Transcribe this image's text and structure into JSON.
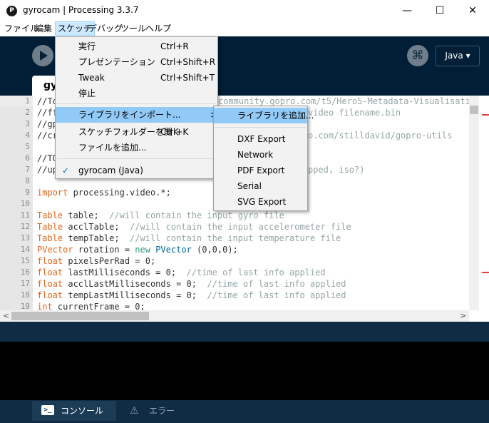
{
  "window": {
    "app_icon": "P",
    "title": "gyrocam | Processing 3.3.7",
    "minimize": "—",
    "maximize": "☐",
    "close": "✕"
  },
  "menubar": [
    "ファイル",
    "編集",
    "スケッチ",
    "デバッグ",
    "ツール",
    "ヘルプ"
  ],
  "toolbar": {
    "mode": "Java ▾",
    "debug_glyph": "⌘"
  },
  "tab": {
    "label": "gy"
  },
  "editor": {
    "line_numbers": [
      "1",
      "2",
      "3",
      "4",
      "5",
      "6",
      "7",
      "8",
      "9",
      "10",
      "11",
      "12",
      "13",
      "14",
      "15",
      "16",
      "17",
      "18",
      "19"
    ],
    "visible_fragments": {
      "l1": "//To",
      "l1_right": "community.gopro.com/t5/Hero5-Metadata-Visualisation",
      "l2": "//ff",
      "l2_right": "video filename.bin",
      "l3": "//gp",
      "l4": "//cr",
      "l4_right": "o.com/stilldavid/gopro-utils",
      "l6": "//TO",
      "l7": "//up",
      "l7_right": "pped, iso?)"
    },
    "l9_kw": "import",
    "l9_rest": " processing.video.*;",
    "l11_type": "Table",
    "l11_rest": " table;  ",
    "l11_comment": "//will contain the input gyro file",
    "l12_type": "Table",
    "l12_rest": " acclTable;  ",
    "l12_comment": "//will contain the input accelerometer file",
    "l13_type": "Table",
    "l13_rest": " tempTable;  ",
    "l13_comment": "//will contain the input temperature file",
    "l14_type": "PVector",
    "l14_a": " rotation = ",
    "l14_new": "new",
    "l14_cls": " PVector",
    "l14_b": " (0,0,0);",
    "l15_type": "float",
    "l15_rest": " pixelsPerRad = 0;",
    "l16_type": "float",
    "l16_rest": " lastMilliseconds = 0;  ",
    "l16_comment": "//time of last info applied",
    "l17_type": "float",
    "l17_rest": " acclLastMilliseconds = 0;  ",
    "l17_comment": "//time of last info applied",
    "l18_type": "float",
    "l18_rest": " tempLastMilliseconds = 0;  ",
    "l18_comment": "//time of last info applied",
    "l19_type": "int",
    "l19_rest": " currentFrame = 0;"
  },
  "scroll": {
    "left": "<",
    "right": ">"
  },
  "sketch_menu": {
    "items": [
      {
        "label": "実行",
        "shortcut": "Ctrl+R"
      },
      {
        "label": "プレゼンテーション",
        "shortcut": "Ctrl+Shift+R"
      },
      {
        "label": "Tweak",
        "shortcut": "Ctrl+Shift+T"
      },
      {
        "label": "停止",
        "shortcut": ""
      },
      {
        "label": "ライブラリをインポート...",
        "shortcut": ""
      },
      {
        "label": "スケッチフォルダーを開く",
        "shortcut": "Ctrl+K"
      },
      {
        "label": "ファイルを追加...",
        "shortcut": ""
      },
      {
        "label": "gyrocam (Java)",
        "shortcut": ""
      }
    ],
    "submenu_arrow": ">",
    "check": "✓"
  },
  "import_submenu": {
    "items": [
      "ライブラリを追加...",
      "DXF Export",
      "Network",
      "PDF Export",
      "Serial",
      "SVG Export"
    ]
  },
  "footer": {
    "console": "コンソール",
    "errors": "エラー",
    "console_icon": ">_",
    "errors_icon": "⚠"
  },
  "colors": {
    "accent": "#001e35",
    "menu_highlight": "#91c9f7",
    "keyword": "#e2661a",
    "type": "#33997e",
    "comment": "#95a5a6"
  }
}
